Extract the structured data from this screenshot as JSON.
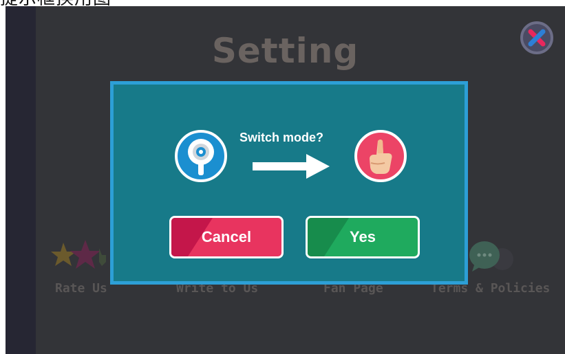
{
  "caption": "提示框换用图",
  "settings": {
    "title": "Setting",
    "close_icon": "close-x-icon",
    "menu": [
      {
        "label": "Rate Us",
        "icon": "stars-icon"
      },
      {
        "label": "Write to Us",
        "icon": "write-icon"
      },
      {
        "label": "Fan Page",
        "icon": "fan-page-icon"
      },
      {
        "label": "Terms & Policies",
        "icon": "speech-bubbles-icon"
      }
    ]
  },
  "dialog": {
    "prompt": "Switch mode?",
    "from_icon": "joystick-icon",
    "arrow_icon": "arrow-right-icon",
    "to_icon": "hand-pointer-icon",
    "cancel_label": "Cancel",
    "yes_label": "Yes"
  },
  "colors": {
    "backdrop": "#333438",
    "dialog_bg": "#177a89",
    "dashed_border_pink": "#e8275d",
    "dashed_border_blue": "#2d9fd6",
    "cancel_button": "#e8345f",
    "yes_button": "#1faa5e",
    "mode_icon_blue": "#1b8fd0",
    "mode_icon_pink": "#ec4466"
  }
}
